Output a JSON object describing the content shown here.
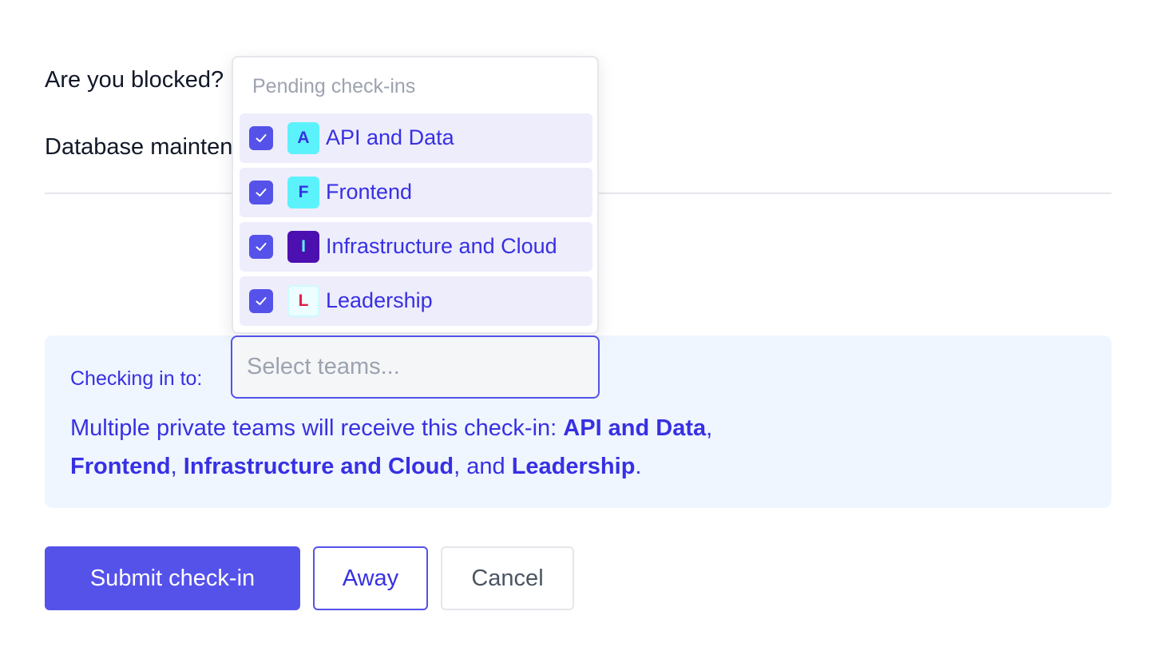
{
  "form": {
    "question": "Are you blocked?",
    "answer": "Database maintenance"
  },
  "dropdown": {
    "header": "Pending check-ins",
    "teams": [
      {
        "letter": "A",
        "name": "API and Data",
        "checked": true,
        "avatar_bg": "#5cf2fc",
        "avatar_fg": "#3730e3"
      },
      {
        "letter": "F",
        "name": "Frontend",
        "checked": true,
        "avatar_bg": "#5cf2fc",
        "avatar_fg": "#3730e3"
      },
      {
        "letter": "I",
        "name": "Infrastructure and Cloud",
        "checked": true,
        "avatar_bg": "#4c0fb0",
        "avatar_fg": "#5cf2fc"
      },
      {
        "letter": "L",
        "name": "Leadership",
        "checked": true,
        "avatar_bg": "#ecfeff",
        "avatar_fg": "#e11d48"
      }
    ]
  },
  "team_select": {
    "placeholder": "Select teams...",
    "value": ""
  },
  "info": {
    "label": "Checking in to:",
    "prefix": "Multiple private teams will receive this check-in: ",
    "team_1": "API and Data",
    "sep_1": ", ",
    "team_2": "Frontend",
    "sep_2": ", ",
    "team_3": "Infrastructure and Cloud",
    "sep_3": ", and ",
    "team_4": "Leadership",
    "suffix": "."
  },
  "buttons": {
    "submit": "Submit check-in",
    "away": "Away",
    "cancel": "Cancel"
  },
  "colors": {
    "accent": "#5552ea",
    "accent_text": "#3730e3",
    "option_bg": "#eeedfc",
    "panel_bg": "#eff6ff"
  }
}
